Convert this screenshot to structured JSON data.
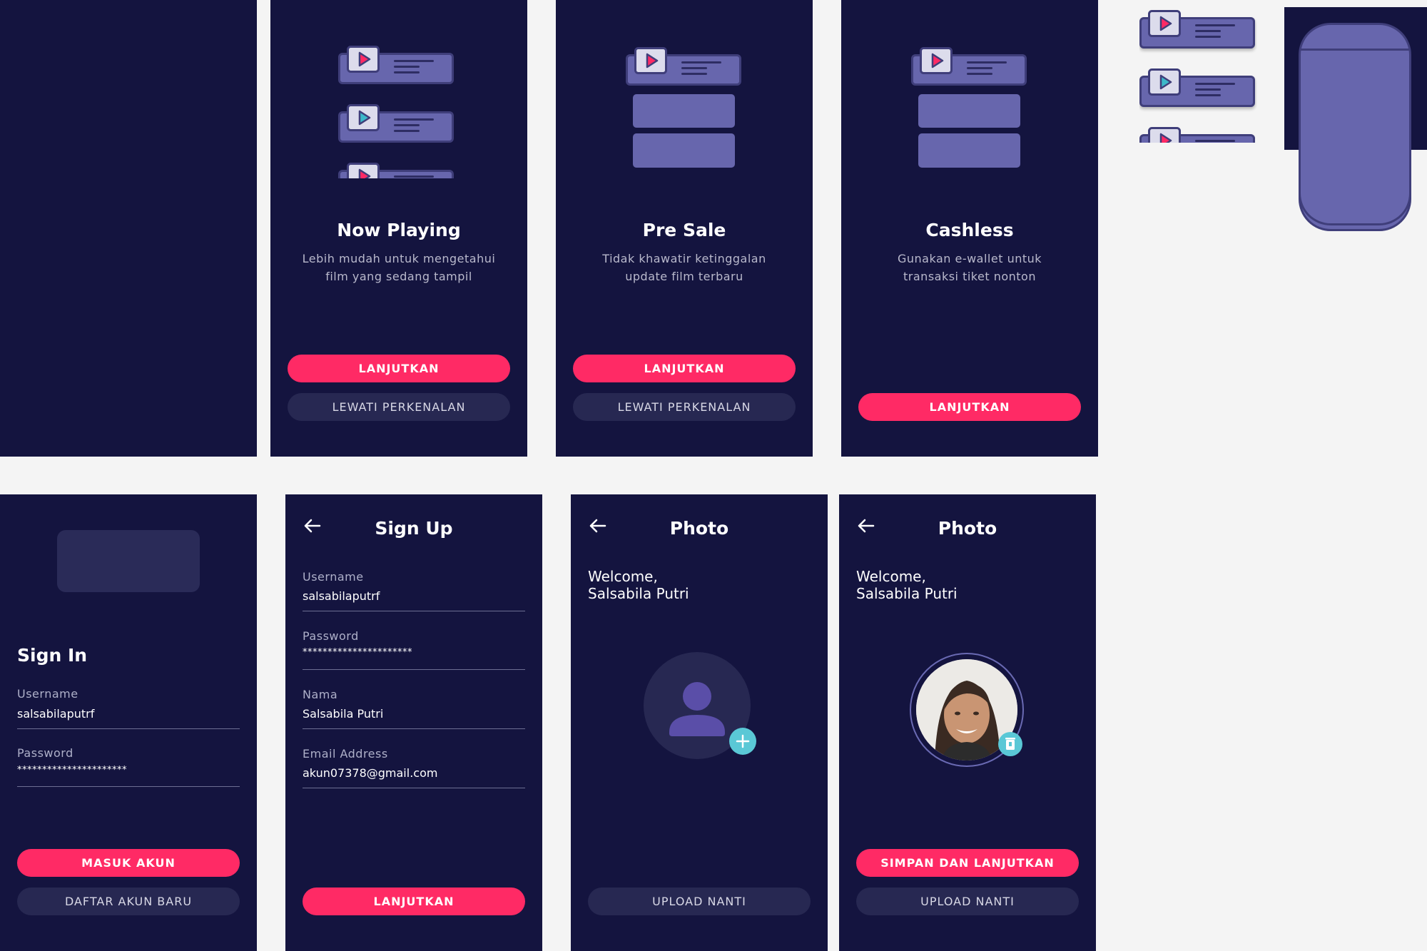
{
  "colors": {
    "background": "#f4f4f4",
    "screen": "#14143f",
    "accent": "#ff2a65",
    "secondary_button": "#272852",
    "illustration_purple": "#6766ad",
    "avatar_badge": "#5ac8d6"
  },
  "onboarding": [
    {
      "title": "Now Playing",
      "subtitle_line1": "Lebih mudah untuk mengetahui",
      "subtitle_line2": "film yang sedang tampil",
      "primary": "LANJUTKAN",
      "secondary": "LEWATI PERKENALAN"
    },
    {
      "title": "Pre Sale",
      "subtitle_line1": "Tidak khawatir ketinggalan",
      "subtitle_line2": "update film terbaru",
      "primary": "LANJUTKAN",
      "secondary": "LEWATI PERKENALAN"
    },
    {
      "title": "Cashless",
      "subtitle_line1": "Gunakan e-wallet untuk",
      "subtitle_line2": "transaksi tiket nonton",
      "primary": "LANJUTKAN"
    }
  ],
  "signin": {
    "title": "Sign In",
    "username_label": "Username",
    "username_value": "salsabilaputrf",
    "password_label": "Password",
    "password_value": "**********************",
    "primary": "MASUK AKUN",
    "secondary": "DAFTAR AKUN BARU"
  },
  "signup": {
    "title": "Sign Up",
    "username_label": "Username",
    "username_value": "salsabilaputrf",
    "password_label": "Password",
    "password_value": "**********************",
    "name_label": "Nama",
    "name_value": "Salsabila Putri",
    "email_label": "Email Address",
    "email_value": "akun07378@gmail.com",
    "primary": "LANJUTKAN"
  },
  "photo_empty": {
    "title": "Photo",
    "welcome_line1": "Welcome,",
    "welcome_line2": "Salsabila Putri",
    "secondary": "UPLOAD NANTI"
  },
  "photo_filled": {
    "title": "Photo",
    "welcome_line1": "Welcome,",
    "welcome_line2": "Salsabila Putri",
    "primary": "SIMPAN DAN LANJUTKAN",
    "secondary": "UPLOAD NANTI"
  },
  "icons": {
    "back": "arrow-left-icon",
    "play": "play-icon",
    "add": "plus-icon",
    "delete": "trash-icon",
    "user": "user-icon"
  }
}
